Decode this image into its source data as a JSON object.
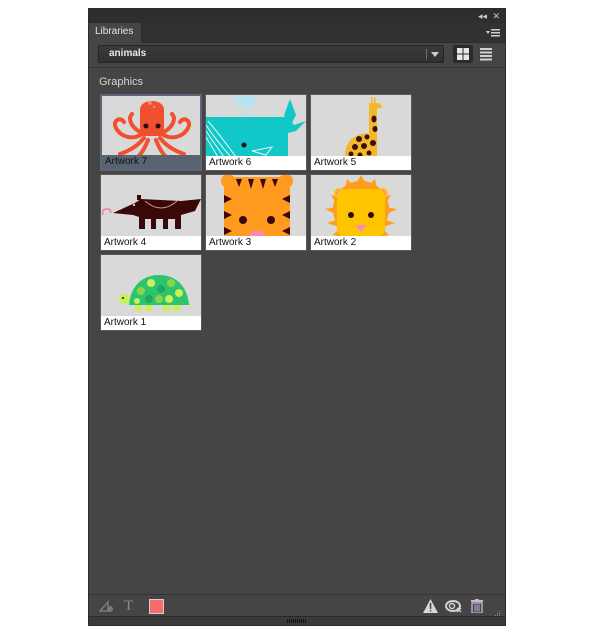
{
  "window": {
    "collapse_icon": "double-chevron-left-icon",
    "close_icon": "close-icon"
  },
  "tabs": [
    {
      "label": "Libraries",
      "active": true
    }
  ],
  "library_select": {
    "value": "animals"
  },
  "view_modes": {
    "grid": "grid-view-icon",
    "list": "list-view-icon",
    "active": "grid"
  },
  "section": {
    "title": "Graphics"
  },
  "graphics": [
    {
      "label": "Artwork 7",
      "animal": "octopus",
      "selected": true
    },
    {
      "label": "Artwork 6",
      "animal": "whale",
      "selected": false
    },
    {
      "label": "Artwork 5",
      "animal": "giraffe",
      "selected": false
    },
    {
      "label": "Artwork 4",
      "animal": "anteater",
      "selected": false
    },
    {
      "label": "Artwork 3",
      "animal": "tiger",
      "selected": false
    },
    {
      "label": "Artwork 2",
      "animal": "lion",
      "selected": false
    },
    {
      "label": "Artwork 1",
      "animal": "turtle",
      "selected": false
    }
  ],
  "footer": {
    "left_icons": [
      "add-character-style-icon",
      "add-text-style-icon",
      "add-color-icon"
    ],
    "color_swatch": "#f76b6b",
    "right_icons": [
      "warning-icon",
      "unlink-icon",
      "trash-icon"
    ]
  },
  "colors": {
    "panel_bg": "#454545",
    "selected_caption": "#5a6372"
  }
}
